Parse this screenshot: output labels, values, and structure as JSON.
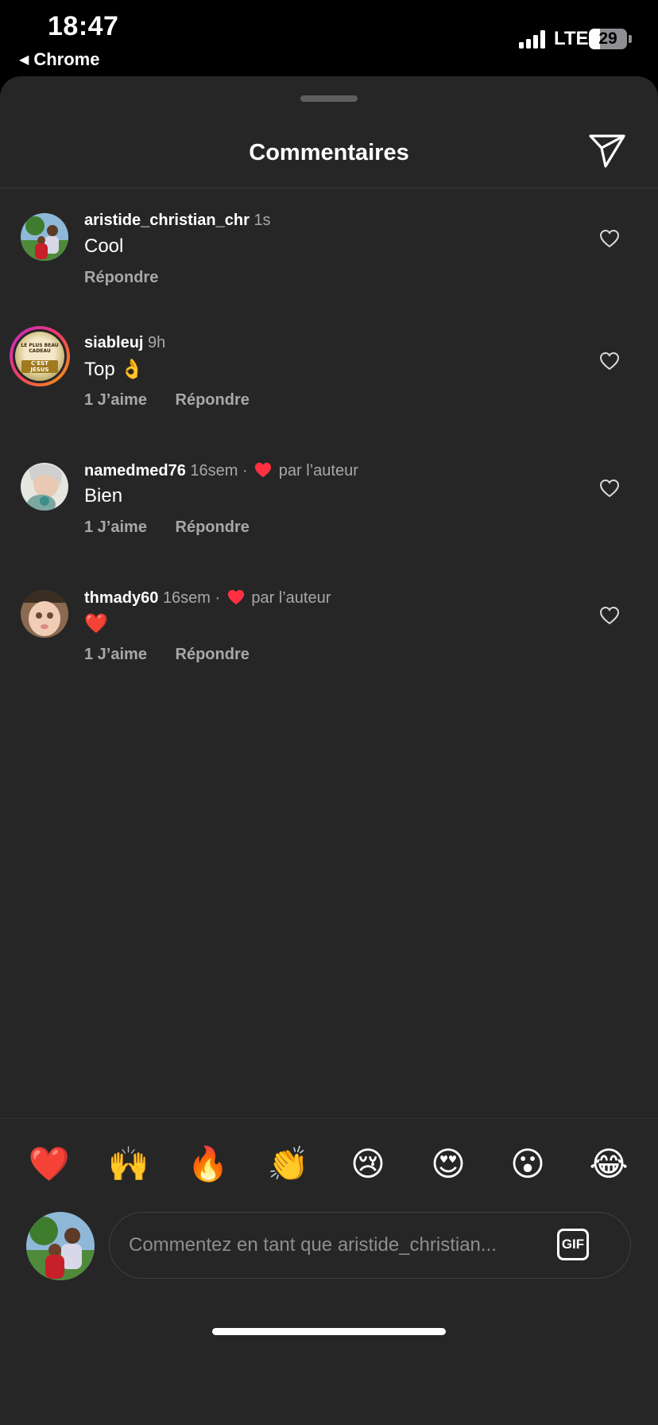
{
  "status_bar": {
    "time": "18:47",
    "back_app": "Chrome",
    "network": "LTE",
    "battery": "29",
    "battery_level": 0.29
  },
  "header": {
    "title": "Commentaires"
  },
  "comments": [
    {
      "username": "aristide_christian_chr",
      "time": "1s",
      "text": "Cool",
      "likes": "",
      "reply": "Répondre",
      "author_liked": ""
    },
    {
      "username": "siableuj",
      "time": "9h",
      "text": "Top 👌",
      "likes": "1 J’aime",
      "reply": "Répondre",
      "author_liked": "",
      "avatar_text": [
        "LE PLUS BEAU CADEAU",
        "C'EST JÉSUS"
      ]
    },
    {
      "username": "namedmed76",
      "time": "16sem",
      "text": "Bien",
      "likes": "1 J’aime",
      "reply": "Répondre",
      "author_liked": "par l’auteur"
    },
    {
      "username": "thmady60",
      "time": "16sem",
      "text": "❤️",
      "likes": "1 J’aime",
      "reply": "Répondre",
      "author_liked": "par l’auteur"
    }
  ],
  "reactions": [
    "❤️",
    "🙌",
    "🔥",
    "👏",
    "😢",
    "😍",
    "😮",
    "😂"
  ],
  "composer": {
    "placeholder": "Commentez en tant que aristide_christian...",
    "gif_label": "GIF"
  },
  "colors": {
    "sheet_bg": "#262626",
    "like_red": "#ff3040",
    "secondary_text": "#a8a8a8"
  }
}
